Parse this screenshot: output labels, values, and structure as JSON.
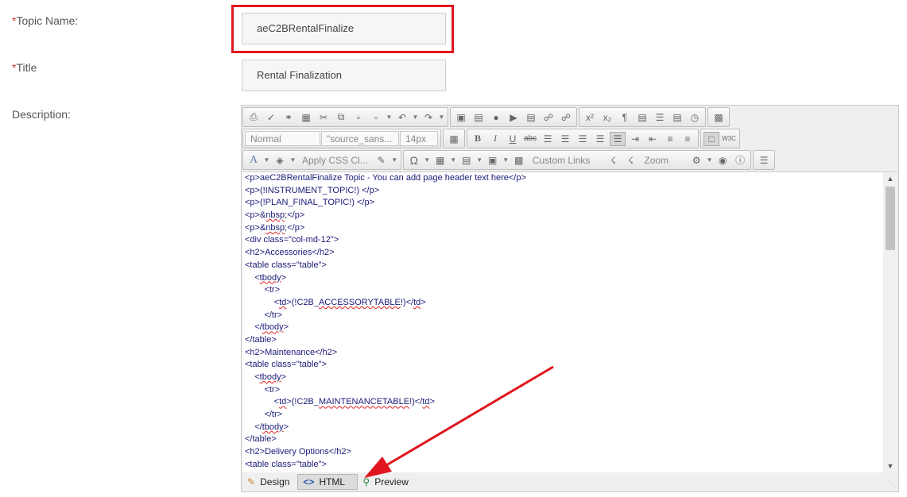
{
  "form": {
    "topic_label_star": "*",
    "topic_label": "Topic Name:",
    "topic_value": "aeC2BRentalFinalize",
    "title_label_star": "*",
    "title_label": "Title",
    "title_value": "Rental Finalization",
    "description_label": "Description:"
  },
  "toolbar": {
    "format": "Normal",
    "font": "\"source_sans...",
    "size": "14px",
    "css_class": "Apply CSS Cl...",
    "custom_links": "Custom Links",
    "zoom": "Zoom"
  },
  "code_lines": [
    "<p>aeC2BRentalFinalize Topic - You can add page header text here</p>",
    "<p>(!INSTRUMENT_TOPIC!) </p>",
    "<p>(!PLAN_FINAL_TOPIC!) </p>",
    "<p>&nbsp;</p>",
    "<p>&nbsp;</p>",
    "<div class=\"col-md-12\">",
    "<h2>Accessories</h2>",
    "<table class=\"table\">",
    "    <tbody>",
    "        <tr>",
    "            <td>(!C2B_ACCESSORYTABLE!)</td>",
    "        </tr>",
    "    </tbody>",
    "</table>",
    "<h2>Maintenance</h2>",
    "<table class=\"table\">",
    "    <tbody>",
    "        <tr>",
    "            <td>(!C2B_MAINTENANCETABLE!)</td>",
    "        </tr>",
    "    </tbody>",
    "</table>",
    "<h2>Delivery Options</h2>",
    "<table class=\"table\">"
  ],
  "tabs": {
    "design": "Design",
    "html": "HTML",
    "preview": "Preview"
  },
  "colors": {
    "highlight": "#e0161e",
    "code_text": "#1a1a7a"
  }
}
